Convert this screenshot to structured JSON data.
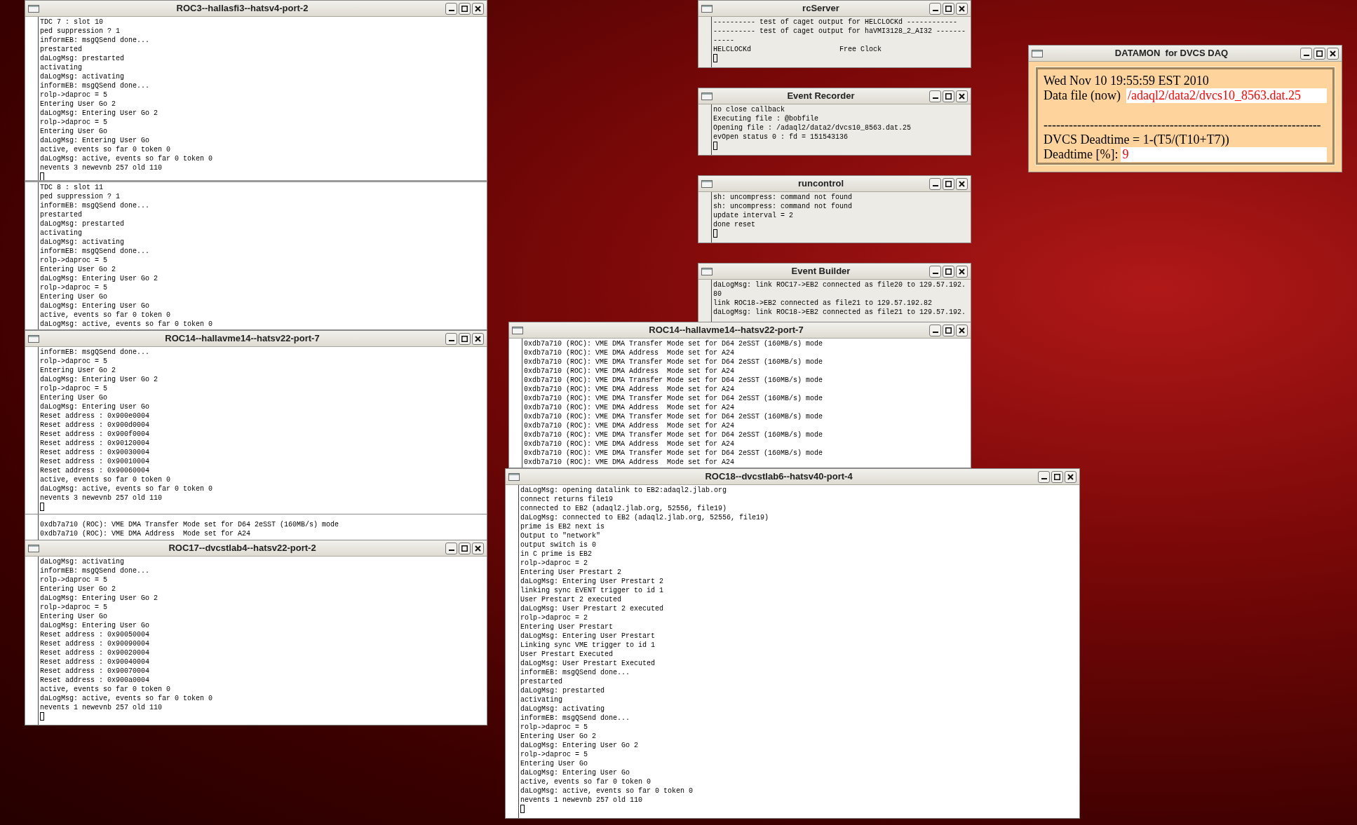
{
  "windows": [
    {
      "kind": "xterm",
      "title": "ROC3--hallasfi3--hatsv4-port-2",
      "panes": [
        {
          "cursor": true,
          "lines": [
            "TDC 7 : slot 10",
            "ped suppression ? 1",
            "informEB: msgQSend done...",
            "prestarted",
            "daLogMsg: prestarted",
            "activating",
            "daLogMsg: activating",
            "informEB: msgQSend done...",
            "rolp->daproc = 5",
            "Entering User Go 2",
            "daLogMsg: Entering User Go 2",
            "rolp->daproc = 5",
            "Entering User Go",
            "daLogMsg: Entering User Go",
            "active, events so far 0 token 0",
            "daLogMsg: active, events so far 0 token 0",
            "nevents 3 newevnb 257 old 110"
          ]
        },
        {
          "cursor": false,
          "lines": [
            "TDC 8 : slot 11",
            "ped suppression ? 1",
            "informEB: msgQSend done...",
            "prestarted",
            "daLogMsg: prestarted",
            "activating",
            "daLogMsg: activating",
            "informEB: msgQSend done...",
            "rolp->daproc = 5",
            "Entering User Go 2",
            "daLogMsg: Entering User Go 2",
            "rolp->daproc = 5",
            "Entering User Go",
            "daLogMsg: Entering User Go",
            "active, events so far 0 token 0",
            "daLogMsg: active, events so far 0 token 0"
          ]
        }
      ]
    },
    {
      "kind": "xterm",
      "title": "ROC14--hallavme14--hatsv22-port-7",
      "panes": [
        {
          "cursor": true,
          "lines": [
            "informEB: msgQSend done...",
            "rolp->daproc = 5",
            "Entering User Go 2",
            "daLogMsg: Entering User Go 2",
            "rolp->daproc = 5",
            "Entering User Go",
            "daLogMsg: Entering User Go",
            "Reset address : 0x900e0004",
            "Reset address : 0x900d0004",
            "Reset address : 0x900f0004",
            "Reset address : 0x90120004",
            "Reset address : 0x90030004",
            "Reset address : 0x90010004",
            "Reset address : 0x90060004",
            "active, events so far 0 token 0",
            "daLogMsg: active, events so far 0 token 0",
            "nevents 3 newevnb 257 old 110"
          ]
        }
      ]
    },
    {
      "kind": "xterm",
      "panes": [
        {
          "cursor": false,
          "lines": [
            "0xdb7a710 (ROC): VME DMA Transfer Mode set for D64 2eSST (160MB/s) mode",
            "0xdb7a710 (ROC): VME DMA Address  Mode set for A24"
          ]
        }
      ]
    },
    {
      "kind": "xterm",
      "title": "ROC17--dvcstlab4--hatsv22-port-2",
      "panes": [
        {
          "cursor": true,
          "lines": [
            "daLogMsg: activating",
            "informEB: msgQSend done...",
            "rolp->daproc = 5",
            "Entering User Go 2",
            "daLogMsg: Entering User Go 2",
            "rolp->daproc = 5",
            "Entering User Go",
            "daLogMsg: Entering User Go",
            "Reset address : 0x90050004",
            "Reset address : 0x90090004",
            "Reset address : 0x90020004",
            "Reset address : 0x90040004",
            "Reset address : 0x90070004",
            "Reset address : 0x900a0004",
            "active, events so far 0 token 0",
            "daLogMsg: active, events so far 0 token 0",
            "nevents 1 newevnb 257 old 110"
          ]
        }
      ]
    },
    {
      "kind": "console",
      "title": "rcServer",
      "panes": [
        {
          "cursor": true,
          "lines": [
            "---------- test of caget output for HELCLOCKd ------------",
            "---------- test of caget output for haVMI3128_2_AI32 -------",
            "-----",
            "HELCLOCKd                     Free Clock"
          ]
        }
      ]
    },
    {
      "kind": "console",
      "title": "Event Recorder",
      "panes": [
        {
          "cursor": true,
          "lines": [
            "no close callback",
            "Executing file : @bobfile",
            "Opening file : /adaql2/data2/dvcs10_8563.dat.25",
            "evOpen status 0 : fd = 151543136"
          ]
        }
      ]
    },
    {
      "kind": "console",
      "title": "runcontrol",
      "panes": [
        {
          "cursor": true,
          "lines": [
            "sh: uncompress: command not found",
            "sh: uncompress: command not found",
            "update interval = 2",
            "done reset"
          ]
        }
      ]
    },
    {
      "kind": "console",
      "title": "Event Builder",
      "panes": [
        {
          "cursor": false,
          "lines": [
            "daLogMsg: link ROC17->EB2 connected as file20 to 129.57.192.",
            "80",
            "link ROC18->EB2 connected as file21 to 129.57.192.82",
            "daLogMsg: link ROC18->EB2 connected as file21 to 129.57.192."
          ]
        }
      ]
    },
    {
      "kind": "xterm",
      "title": "ROC14--hallavme14--hatsv22-port-7",
      "panes": [
        {
          "cursor": false,
          "lines": [
            "0xdb7a710 (ROC): VME DMA Transfer Mode set for D64 2eSST (160MB/s) mode",
            "0xdb7a710 (ROC): VME DMA Address  Mode set for A24",
            "0xdb7a710 (ROC): VME DMA Transfer Mode set for D64 2eSST (160MB/s) mode",
            "0xdb7a710 (ROC): VME DMA Address  Mode set for A24",
            "0xdb7a710 (ROC): VME DMA Transfer Mode set for D64 2eSST (160MB/s) mode",
            "0xdb7a710 (ROC): VME DMA Address  Mode set for A24",
            "0xdb7a710 (ROC): VME DMA Transfer Mode set for D64 2eSST (160MB/s) mode",
            "0xdb7a710 (ROC): VME DMA Address  Mode set for A24",
            "0xdb7a710 (ROC): VME DMA Transfer Mode set for D64 2eSST (160MB/s) mode",
            "0xdb7a710 (ROC): VME DMA Address  Mode set for A24",
            "0xdb7a710 (ROC): VME DMA Transfer Mode set for D64 2eSST (160MB/s) mode",
            "0xdb7a710 (ROC): VME DMA Address  Mode set for A24",
            "0xdb7a710 (ROC): VME DMA Transfer Mode set for D64 2eSST (160MB/s) mode",
            "0xdb7a710 (ROC): VME DMA Address  Mode set for A24"
          ]
        }
      ]
    },
    {
      "kind": "xterm",
      "title": "ROC18--dvcstlab6--hatsv40-port-4",
      "panes": [
        {
          "cursor": true,
          "lines": [
            "daLogMsg: opening datalink to EB2:adaql2.jlab.org",
            "connect returns file19",
            "connected to EB2 (adaql2.jlab.org, 52556, file19)",
            "daLogMsg: connected to EB2 (adaql2.jlab.org, 52556, file19)",
            "prime is EB2 next is",
            "Output to \"network\"",
            "output switch is 0",
            "in C prime is EB2",
            "rolp->daproc = 2",
            "Entering User Prestart 2",
            "daLogMsg: Entering User Prestart 2",
            "linking sync EVENT trigger to id 1",
            "User Prestart 2 executed",
            "daLogMsg: User Prestart 2 executed",
            "rolp->daproc = 2",
            "Entering User Prestart",
            "daLogMsg: Entering User Prestart",
            "Linking sync VME trigger to id 1",
            "User Prestart Executed",
            "daLogMsg: User Prestart Executed",
            "informEB: msgQSend done...",
            "prestarted",
            "daLogMsg: prestarted",
            "activating",
            "daLogMsg: activating",
            "informEB: msgQSend done...",
            "rolp->daproc = 5",
            "Entering User Go 2",
            "daLogMsg: Entering User Go 2",
            "rolp->daproc = 5",
            "Entering User Go",
            "daLogMsg: Entering User Go",
            "active, events so far 0 token 0",
            "daLogMsg: active, events so far 0 token 0",
            "nevents 1 newevnb 257 old 110"
          ]
        }
      ]
    }
  ],
  "datamon": {
    "title": "DATAMON  for DVCS DAQ",
    "datetime": "Wed Nov 10 19:55:59 EST 2010",
    "data_file": {
      "label": "Data file (now)",
      "value": "/adaql2/data2/dvcs10_8563.dat.25"
    },
    "separator": "------------------------------------------------------------------",
    "formula": "DVCS Deadtime = 1-(T5/(T10+T7))",
    "deadtime": {
      "label": "Deadtime [%]:",
      "value": "9"
    }
  }
}
